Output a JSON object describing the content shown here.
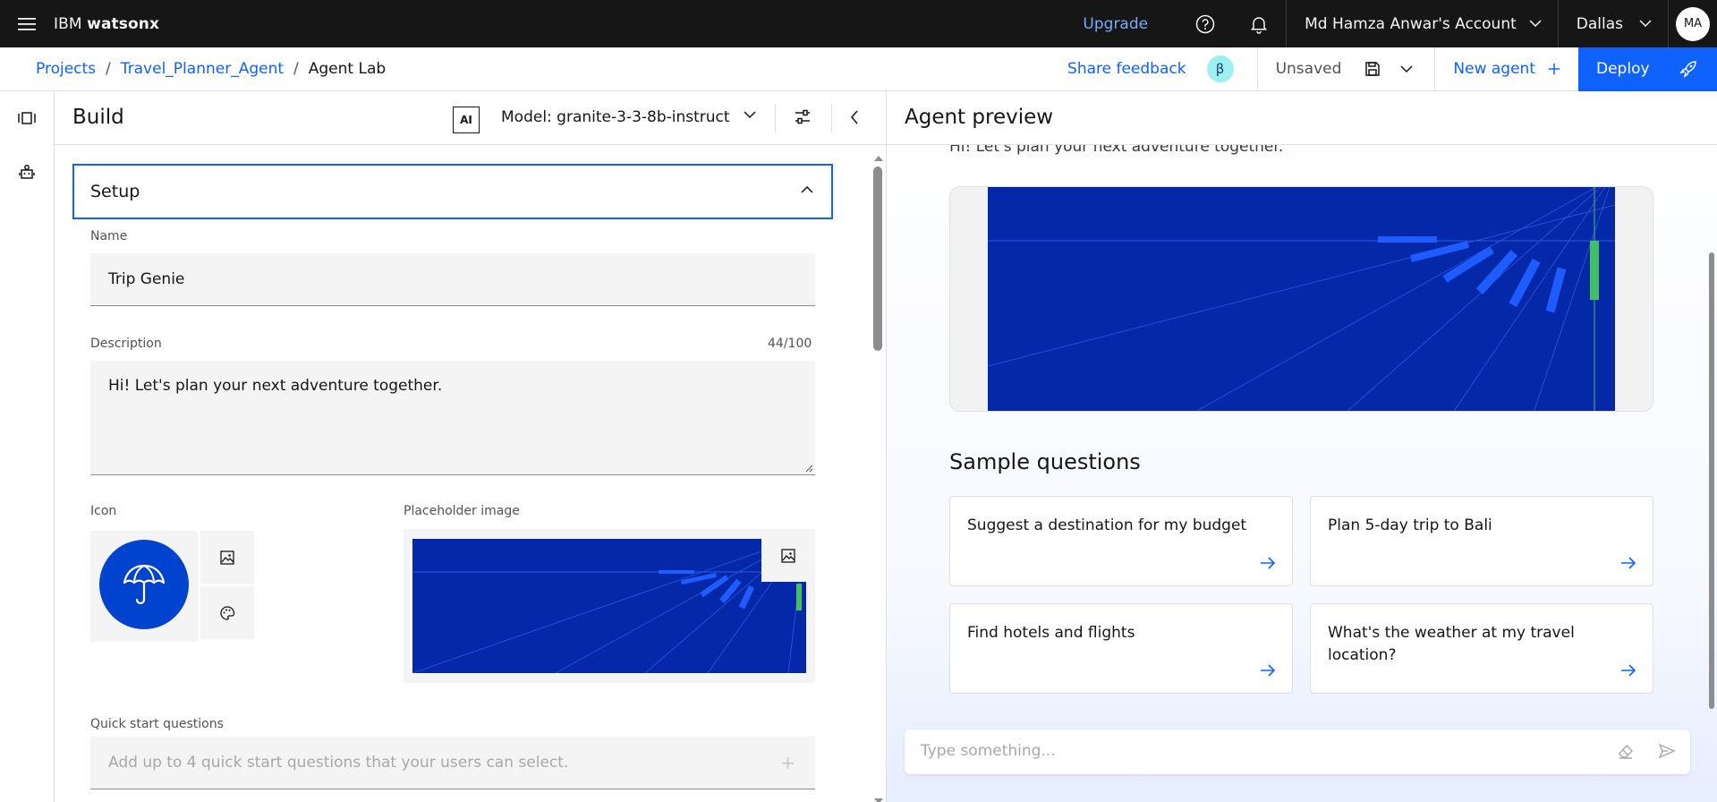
{
  "topbar": {
    "brand_prefix": "IBM",
    "brand_name": "watsonx",
    "upgrade": "Upgrade",
    "account": "Md Hamza Anwar's Account",
    "region": "Dallas",
    "avatar_initials": "MA"
  },
  "subbar": {
    "breadcrumbs": [
      "Projects",
      "Travel_Planner_Agent",
      "Agent Lab"
    ],
    "separator": "/",
    "share_feedback": "Share feedback",
    "beta": "β",
    "unsaved": "Unsaved",
    "new_agent": "New agent",
    "deploy": "Deploy"
  },
  "build": {
    "title": "Build",
    "ai_badge": "AI",
    "model_label": "Model: granite-3-3-8b-instruct",
    "setup_label": "Setup",
    "name_label": "Name",
    "name_value": "Trip Genie",
    "description_label": "Description",
    "description_counter": "44/100",
    "description_value": "Hi! Let's plan your next adventure together.",
    "icon_label": "Icon",
    "placeholder_image_label": "Placeholder image",
    "quick_start_label": "Quick start questions",
    "quick_start_placeholder": "Add up to 4 quick start questions that your users can select.",
    "quick_start_plus": "+"
  },
  "preview": {
    "title": "Agent preview",
    "greeting": "Hi! Let's plan your next adventure together.",
    "sample_questions_title": "Sample questions",
    "sample_questions": [
      "Suggest a destination for my budget",
      "Plan 5-day trip to Bali",
      "Find hotels and flights",
      "What's the weather at my travel location?"
    ],
    "chat_placeholder": "Type something..."
  },
  "colors": {
    "header_bg": "#161616",
    "primary_blue": "#0f62fe",
    "hero_blue": "#0528a8",
    "accent_green": "#42be65"
  },
  "icons": [
    "menu-icon",
    "help-icon",
    "notification-icon",
    "chevron-down-icon",
    "save-icon",
    "add-icon",
    "rocket-icon",
    "sidebar-panel-icon",
    "agent-icon",
    "tune-icon",
    "chevron-left-icon",
    "chevron-up-icon",
    "image-icon",
    "palette-icon",
    "umbrella-icon",
    "arrow-right-icon",
    "eraser-icon",
    "send-icon"
  ]
}
